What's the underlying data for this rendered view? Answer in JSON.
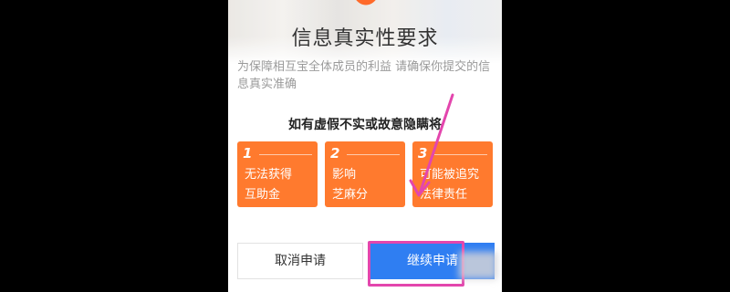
{
  "dialog": {
    "title": "信息真实性要求",
    "subtitle": "为保障相互宝全体成员的利益  请确保你提交的信息真实准确",
    "warning": "如有虚假不实或故意隐瞒将",
    "cards": [
      {
        "num": "1",
        "line1": "无法获得",
        "line2": "互助金"
      },
      {
        "num": "2",
        "line1": "影响",
        "line2": "芝麻分"
      },
      {
        "num": "3",
        "line1": "可能被追究",
        "line2": "法律责任"
      }
    ],
    "buttons": {
      "cancel": "取消申请",
      "continue": "继续申请"
    }
  },
  "colors": {
    "card": "#ff7a2e",
    "primary_button": "#2f7ef2",
    "annotation": "#e346ad"
  }
}
